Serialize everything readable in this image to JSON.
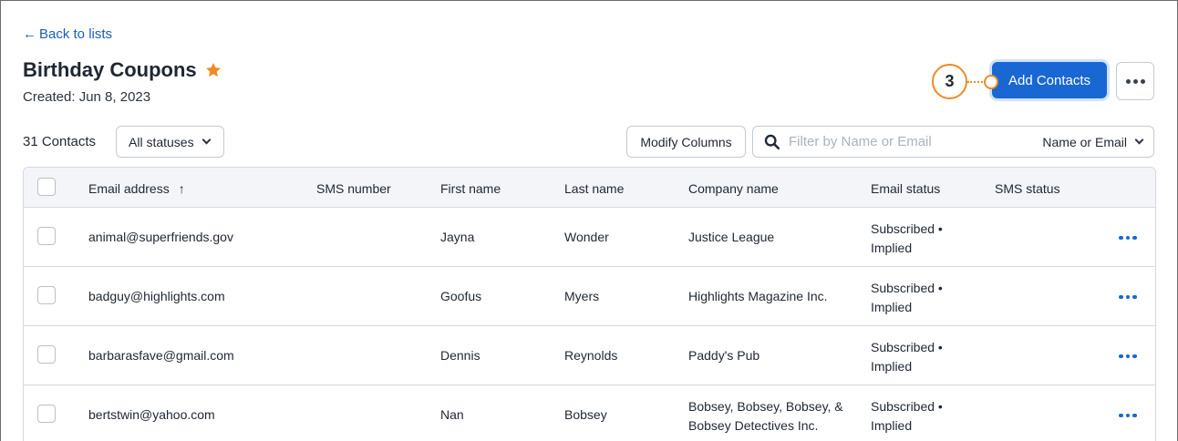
{
  "nav": {
    "back_label": "Back to lists"
  },
  "list": {
    "title": "Birthday Coupons",
    "created": "Created: Jun 8, 2023"
  },
  "actions": {
    "add_contacts_label": "Add Contacts",
    "step_number": "3"
  },
  "toolbar": {
    "contact_count": "31 Contacts",
    "status_filter": "All statuses",
    "modify_columns_label": "Modify Columns",
    "search_placeholder": "Filter by Name or Email",
    "search_value": "",
    "search_type": "Name or Email"
  },
  "table": {
    "columns": [
      "Email address",
      "SMS number",
      "First name",
      "Last name",
      "Company name",
      "Email status",
      "SMS status"
    ],
    "rows": [
      {
        "email": "animal@superfriends.gov",
        "sms": "",
        "first": "Jayna",
        "last": "Wonder",
        "company": [
          "Justice League"
        ],
        "email_status": [
          "Subscribed •",
          "Implied"
        ],
        "sms_status": ""
      },
      {
        "email": "badguy@highlights.com",
        "sms": "",
        "first": "Goofus",
        "last": "Myers",
        "company": [
          "Highlights Magazine Inc."
        ],
        "email_status": [
          "Subscribed •",
          "Implied"
        ],
        "sms_status": ""
      },
      {
        "email": "barbarasfave@gmail.com",
        "sms": "",
        "first": "Dennis",
        "last": "Reynolds",
        "company": [
          "Paddy's Pub"
        ],
        "email_status": [
          "Subscribed •",
          "Implied"
        ],
        "sms_status": ""
      },
      {
        "email": "bertstwin@yahoo.com",
        "sms": "",
        "first": "Nan",
        "last": "Bobsey",
        "company": [
          "Bobsey, Bobsey, Bobsey, &",
          "Bobsey Detectives Inc."
        ],
        "email_status": [
          "Subscribed •",
          "Implied"
        ],
        "sms_status": ""
      }
    ]
  },
  "colors": {
    "primary": "#1967d2",
    "link": "#1a5fb4",
    "star": "#f08a24",
    "callout": "#f08a24"
  },
  "icons": {
    "back": "arrow-left-icon",
    "favorite": "star-icon",
    "more": "more-horizontal-icon",
    "search": "search-icon",
    "sort": "arrow-up-icon",
    "dropdown": "chevron-down-icon"
  }
}
